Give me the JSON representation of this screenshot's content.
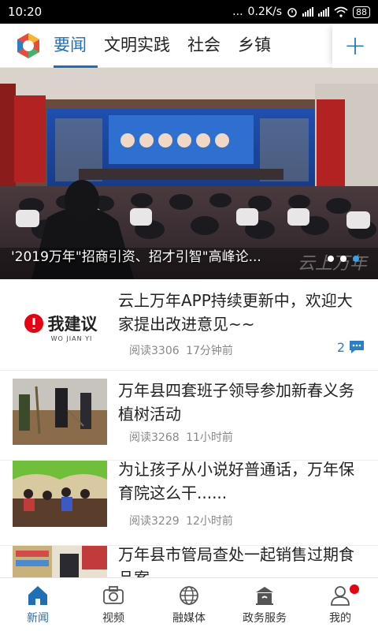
{
  "status_bar": {
    "time": "10:20",
    "dots": "...",
    "speed": "0.2K/s",
    "battery": "88"
  },
  "top_nav": {
    "tabs": [
      {
        "label": "要闻",
        "active": true
      },
      {
        "label": "文明实践",
        "active": false
      },
      {
        "label": "社会",
        "active": false
      },
      {
        "label": "乡镇",
        "active": false
      }
    ],
    "add_label": "+"
  },
  "banner": {
    "caption": "'2019万年\"招商引资、招才引智\"高峰论...",
    "slide_count": 3,
    "active_slide": 3,
    "watermark": "云上万年"
  },
  "news": [
    {
      "title": "云上万年APP持续更新中，欢迎大家提出改进意见~~",
      "reads": "阅读3306",
      "time": "17分钟前",
      "comments": "2",
      "thumb_text": "我建议",
      "thumb_sub": "WO JIAN YI"
    },
    {
      "title": "万年县四套班子领导参加新春义务植树活动",
      "reads": "阅读3268",
      "time": "11小时前"
    },
    {
      "title": "为让孩子从小说好普通话，万年保育院这么干......",
      "reads": "阅读3229",
      "time": "12小时前"
    },
    {
      "title": "万年县市管局查处一起销售过期食品案",
      "reads": "",
      "time": ""
    }
  ],
  "bottom_nav": [
    {
      "label": "新闻",
      "icon": "home-icon",
      "active": true
    },
    {
      "label": "视频",
      "icon": "camera-icon",
      "active": false
    },
    {
      "label": "融媒体",
      "icon": "globe-icon",
      "active": false
    },
    {
      "label": "政务服务",
      "icon": "government-icon",
      "active": false
    },
    {
      "label": "我的",
      "icon": "person-icon",
      "active": false,
      "badge": true
    }
  ],
  "colors": {
    "accent": "#1f6fb7",
    "badge": "#e60012",
    "status_bar": "#000000"
  }
}
